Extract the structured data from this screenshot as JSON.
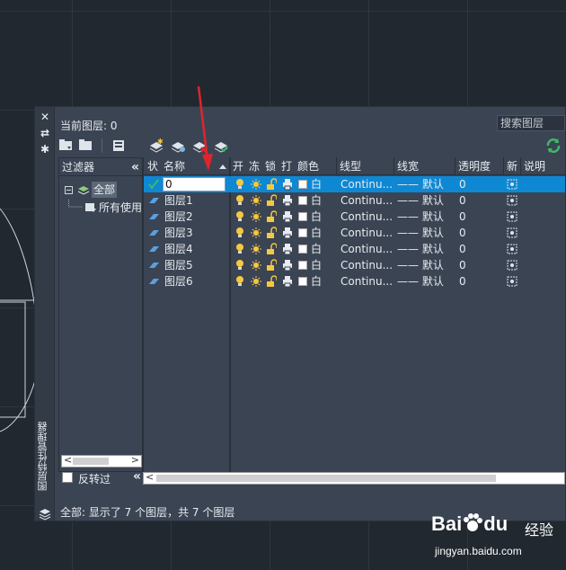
{
  "palette": {
    "title": "图层特性管理器",
    "current_layer": "当前图层: 0",
    "search_placeholder": "搜索图层",
    "status_text": "全部: 显示了 7 个图层，共 7 个图层"
  },
  "filters": {
    "header": "过滤器",
    "collapse_glyph": "«",
    "tree": {
      "root_label": "全部",
      "child_label": "所有使用的图层"
    },
    "invert_label": "反转过",
    "invert_collapse_glyph": "«"
  },
  "table": {
    "columns": {
      "status": "状",
      "name": "名称",
      "on": "开",
      "freeze": "冻",
      "lock": "锁",
      "plot": "打",
      "color": "颜色",
      "linetype": "线型",
      "lineweight": "线宽",
      "transparency": "透明度",
      "new_vp": "新",
      "description": "说明"
    },
    "rows": [
      {
        "name": "0",
        "color": "白",
        "linetype": "Continu...",
        "lineweight": "—— 默认",
        "transparency": "0",
        "current": true
      },
      {
        "name": "图层1",
        "color": "白",
        "linetype": "Continu...",
        "lineweight": "—— 默认",
        "transparency": "0",
        "current": false
      },
      {
        "name": "图层2",
        "color": "白",
        "linetype": "Continu...",
        "lineweight": "—— 默认",
        "transparency": "0",
        "current": false
      },
      {
        "name": "图层3",
        "color": "白",
        "linetype": "Continu...",
        "lineweight": "—— 默认",
        "transparency": "0",
        "current": false
      },
      {
        "name": "图层4",
        "color": "白",
        "linetype": "Continu...",
        "lineweight": "—— 默认",
        "transparency": "0",
        "current": false
      },
      {
        "name": "图层5",
        "color": "白",
        "linetype": "Continu...",
        "lineweight": "—— 默认",
        "transparency": "0",
        "current": false
      },
      {
        "name": "图层6",
        "color": "白",
        "linetype": "Continu...",
        "lineweight": "—— 默认",
        "transparency": "0",
        "current": false
      }
    ]
  },
  "side_strip": {
    "close_glyph": "✕",
    "autohide_glyph": "⇄",
    "settings_glyph": "✱"
  },
  "colors": {
    "panel_bg": "#3b4453",
    "selection": "#0e88d3",
    "annotation_arrow": "#e0242b",
    "bulb": "#f5c842",
    "check": "#3cb96a",
    "refresh": "#3cb96a"
  },
  "watermark": {
    "brand": "Bai",
    "brand_suffix": "du",
    "cn": "经验",
    "url": "jingyan.baidu.com"
  }
}
